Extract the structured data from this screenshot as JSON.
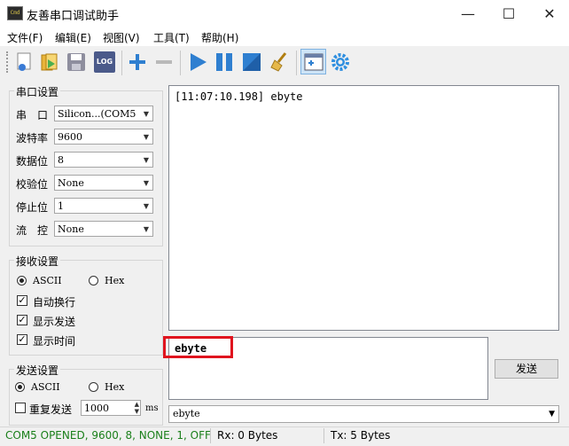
{
  "window": {
    "title": "友善串口调试助手",
    "app_icon_text": "Cmd",
    "minimize": "—",
    "maximize": "☐",
    "close": "✕"
  },
  "menu": [
    "文件(F)",
    "编辑(E)",
    "视图(V)",
    "工具(T)",
    "帮助(H)"
  ],
  "toolbar": {
    "icons": [
      "new-icon",
      "open-icon",
      "save-icon",
      "log-icon",
      "add-icon",
      "remove-icon",
      "start-icon",
      "pause-icon",
      "stop-icon",
      "clear-icon",
      "window-icon",
      "settings-icon"
    ],
    "log_label": "LOG"
  },
  "serial": {
    "title": "串口设置",
    "port_label": "串　口",
    "port_value": "Silicon...(COM5",
    "baud_label": "波特率",
    "baud_value": "9600",
    "databits_label": "数据位",
    "databits_value": "8",
    "parity_label": "校验位",
    "parity_value": "None",
    "stopbits_label": "停止位",
    "stopbits_value": "1",
    "flow_label": "流　控",
    "flow_value": "None"
  },
  "receive_settings": {
    "title": "接收设置",
    "ascii": "ASCII",
    "hex": "Hex",
    "ascii_selected": true,
    "auto_wrap": "自动换行",
    "show_send": "显示发送",
    "show_time": "显示时间"
  },
  "send_settings": {
    "title": "发送设置",
    "ascii": "ASCII",
    "hex": "Hex",
    "repeat": "重复发送",
    "interval": "1000",
    "unit": "ms"
  },
  "receive_text": "[11:07:10.198] ebyte",
  "send_text": "ebyte",
  "send_button": "发送",
  "history_value": "ebyte",
  "status": {
    "port_state": "COM5 OPENED, 9600, 8, NONE, 1, OFF",
    "rx": "Rx: 0 Bytes",
    "tx": "Tx: 5 Bytes",
    "port_state_color": "#1a7f1a",
    "highlight_color": "#e0141e"
  }
}
